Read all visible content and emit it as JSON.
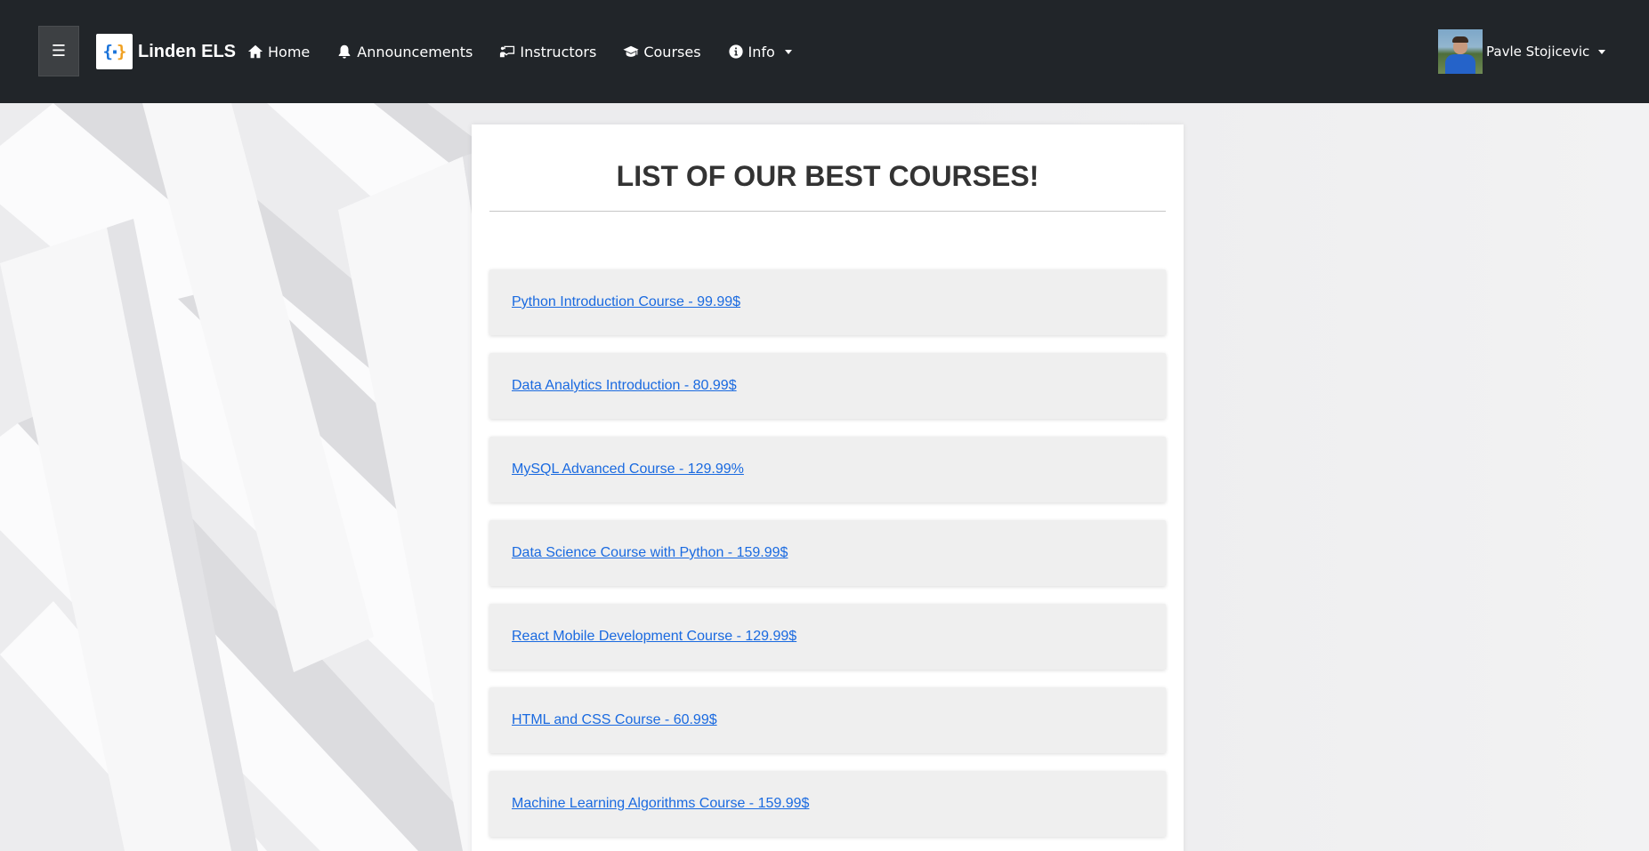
{
  "navbar": {
    "menu_icon": "hamburger-icon",
    "brand": "Linden ELS",
    "links": [
      {
        "label": "Home",
        "icon": "home-icon"
      },
      {
        "label": "Announcements",
        "icon": "bell-icon"
      },
      {
        "label": "Instructors",
        "icon": "chalkboard-teacher-icon"
      },
      {
        "label": "Courses",
        "icon": "graduation-cap-icon"
      },
      {
        "label": "Info",
        "icon": "info-circle-icon"
      }
    ],
    "user_name": "Pavle Stojicevic"
  },
  "main": {
    "title": "LIST OF OUR BEST COURSES!",
    "courses": [
      "Python Introduction Course - 99.99$",
      "Data Analytics Introduction - 80.99$",
      "MySQL Advanced Course - 129.99%",
      "Data Science Course with Python - 159.99$",
      "React Mobile Development Course - 129.99$",
      "HTML and CSS Course - 60.99$",
      "Machine Learning Algorithms Course - 159.99$"
    ]
  },
  "colors": {
    "navbar": "#212529",
    "link": "#1a6ae0",
    "card": "#ffffff",
    "course_bg": "#efefef"
  }
}
